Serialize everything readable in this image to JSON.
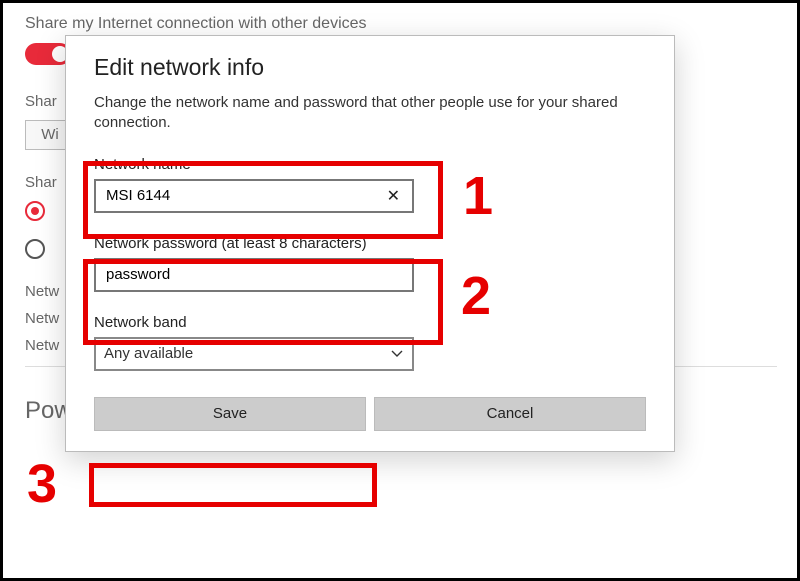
{
  "background": {
    "share_heading": "Share my Internet connection with other devices",
    "share_label_1": "Shar",
    "share_label_2": "Shar",
    "wifi_abbr": "Wi",
    "net_line1": "Netw",
    "net_line2": "Netw",
    "net_line3": "Netw",
    "power_saving": "Power saving"
  },
  "dialog": {
    "title": "Edit network info",
    "description": "Change the network name and password that other people use for your shared connection.",
    "name_label": "Network name",
    "name_value": "MSI 6144",
    "password_label": "Network password (at least 8 characters)",
    "password_value": "password",
    "band_label": "Network band",
    "band_value": "Any available",
    "save_label": "Save",
    "cancel_label": "Cancel"
  },
  "annotations": {
    "n1": "1",
    "n2": "2",
    "n3": "3"
  }
}
